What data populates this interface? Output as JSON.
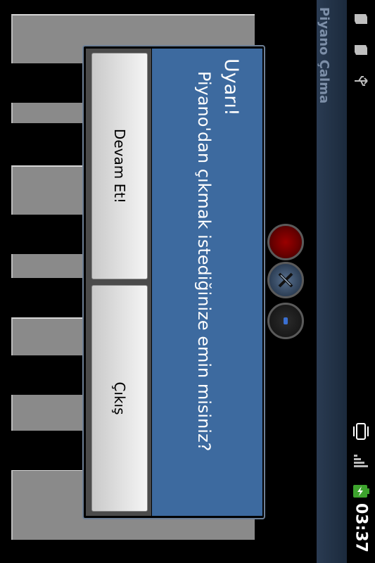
{
  "status_bar": {
    "time": "03:37",
    "icons": [
      "notification-icon",
      "notification-icon",
      "usb-icon",
      "vibrate-icon",
      "signal-icon",
      "battery-charging-icon"
    ]
  },
  "title_bar": {
    "title": "Piyano Çalma"
  },
  "controls": {
    "buttons": [
      "record-button",
      "settings-button",
      "info-button"
    ]
  },
  "dialog": {
    "title": "Uyarı!",
    "message": "Piyano'dan çıkmak istediğinize emin misiniz?",
    "continue_label": "Devam Et!",
    "exit_label": "Çıkış"
  },
  "colors": {
    "dialog_panel": "#3d6a9f",
    "title_bar": "#233348"
  }
}
